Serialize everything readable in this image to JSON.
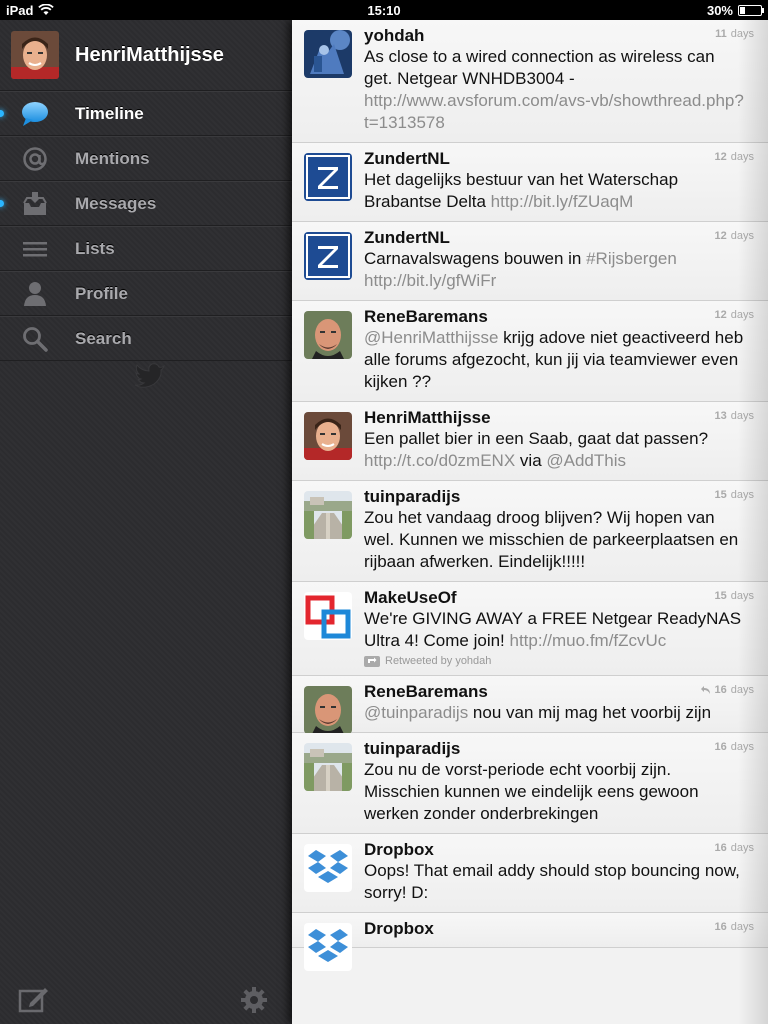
{
  "status_bar": {
    "device": "iPad",
    "time": "15:10",
    "battery": "30%",
    "battery_level": 0.3
  },
  "sidebar": {
    "username": "HenriMatthijsse",
    "nav": [
      {
        "label": "Timeline",
        "icon": "speech-bubble-icon",
        "active": true,
        "unread": true
      },
      {
        "label": "Mentions",
        "icon": "at-sign-icon",
        "active": false,
        "unread": false
      },
      {
        "label": "Messages",
        "icon": "inbox-icon",
        "active": false,
        "unread": true
      },
      {
        "label": "Lists",
        "icon": "list-icon",
        "active": false,
        "unread": false
      },
      {
        "label": "Profile",
        "icon": "person-icon",
        "active": false,
        "unread": false
      },
      {
        "label": "Search",
        "icon": "magnifier-icon",
        "active": false,
        "unread": false
      }
    ]
  },
  "timeline": {
    "tweets": [
      {
        "user": "yohdah",
        "time": "11",
        "unit": "days",
        "avatar": "yohdah-avatar",
        "parts": [
          {
            "t": "As close to a wired connection as wireless can get. Netgear WNHDB3004 - "
          },
          {
            "t": "http://www.avsforum.com/avs-vb/showthread.php?t=1313578",
            "k": "link"
          }
        ]
      },
      {
        "user": "ZundertNL",
        "time": "12",
        "unit": "days",
        "avatar": "zundert-avatar",
        "parts": [
          {
            "t": "Het dagelijks bestuur van het Waterschap Brabantse Delta "
          },
          {
            "t": "http://bit.ly/fZUaqM",
            "k": "link"
          }
        ]
      },
      {
        "user": "ZundertNL",
        "time": "12",
        "unit": "days",
        "avatar": "zundert-avatar",
        "parts": [
          {
            "t": "Carnavalswagens bouwen in "
          },
          {
            "t": "#Rijsbergen",
            "k": "hashtag"
          },
          {
            "t": " "
          },
          {
            "t": "http://bit.ly/gfWiFr",
            "k": "link"
          }
        ]
      },
      {
        "user": "ReneBaremans",
        "time": "12",
        "unit": "days",
        "avatar": "rene-avatar",
        "parts": [
          {
            "t": "@HenriMatthijsse",
            "k": "mention"
          },
          {
            "t": "  krijg adove niet geactiveerd heb alle forums afgezocht, kun jij via teamviewer even kijken ??"
          }
        ]
      },
      {
        "user": "HenriMatthijsse",
        "time": "13",
        "unit": "days",
        "avatar": "henri-avatar",
        "parts": [
          {
            "t": "Een pallet bier in een Saab, gaat dat passen? "
          },
          {
            "t": "http://t.co/d0zmENX",
            "k": "link"
          },
          {
            "t": " via "
          },
          {
            "t": "@AddThis",
            "k": "mention"
          }
        ]
      },
      {
        "user": "tuinparadijs",
        "time": "15",
        "unit": "days",
        "avatar": "tuin-avatar",
        "parts": [
          {
            "t": "Zou het vandaag droog blijven? Wij hopen van wel. Kunnen we misschien de parkeerplaatsen en rijbaan afwerken. Eindelijk!!!!!"
          }
        ]
      },
      {
        "user": "MakeUseOf",
        "time": "15",
        "unit": "days",
        "avatar": "muo-avatar",
        "parts": [
          {
            "t": "We're GIVING AWAY a FREE Netgear ReadyNAS Ultra 4! Come join! "
          },
          {
            "t": "http://muo.fm/fZcvUc",
            "k": "link"
          }
        ],
        "retweeted_by": "Retweeted by yohdah"
      },
      {
        "user": "ReneBaremans",
        "time": "16",
        "unit": "days",
        "avatar": "rene-avatar",
        "reply": true,
        "parts": [
          {
            "t": "@tuinparadijs",
            "k": "mention"
          },
          {
            "t": " nou van mij mag het voorbij zijn"
          }
        ]
      },
      {
        "user": "tuinparadijs",
        "time": "16",
        "unit": "days",
        "avatar": "tuin-avatar",
        "parts": [
          {
            "t": "Zou nu de vorst-periode echt voorbij zijn. Misschien kunnen we eindelijk eens gewoon werken zonder onderbrekingen"
          }
        ]
      },
      {
        "user": "Dropbox",
        "time": "16",
        "unit": "days",
        "avatar": "dropbox-avatar",
        "parts": [
          {
            "t": "Oops! That email addy should stop bouncing now, sorry! D:"
          }
        ]
      },
      {
        "user": "Dropbox",
        "time": "16",
        "unit": "days",
        "avatar": "dropbox-avatar",
        "parts": []
      }
    ]
  }
}
